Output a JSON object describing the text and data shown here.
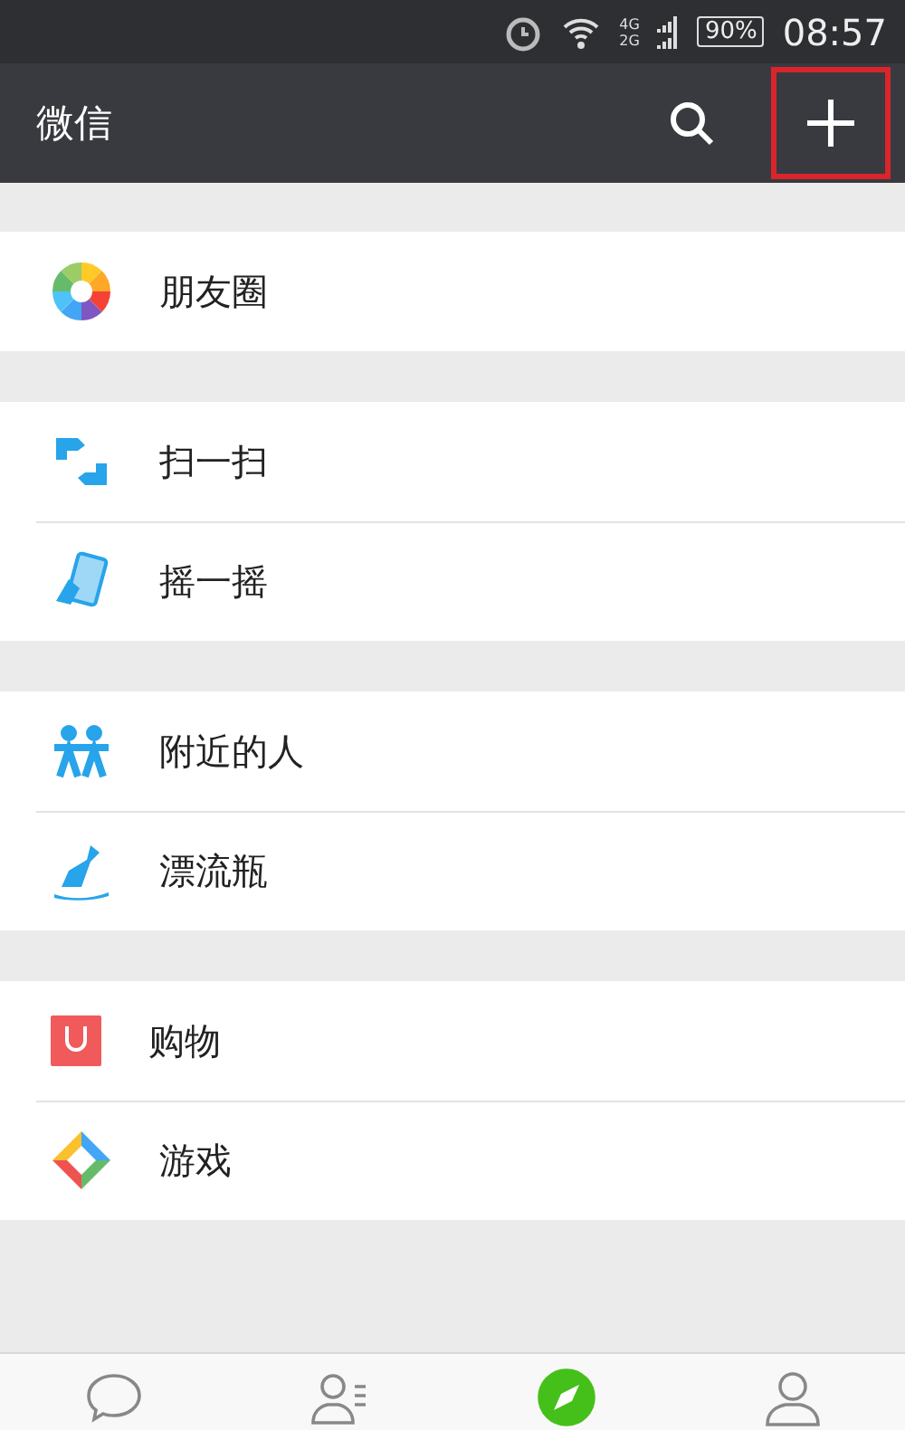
{
  "status_bar": {
    "network_top": "4G",
    "network_bottom": "2G",
    "battery": "90%",
    "time": "08:57"
  },
  "header": {
    "title": "微信",
    "add_button": {
      "highlighted": true
    }
  },
  "groups": [
    {
      "items": [
        {
          "kind": "moments",
          "label": "朋友圈"
        }
      ]
    },
    {
      "items": [
        {
          "kind": "scan",
          "label": "扫一扫"
        },
        {
          "kind": "shake",
          "label": "摇一摇"
        }
      ]
    },
    {
      "items": [
        {
          "kind": "nearby",
          "label": "附近的人"
        },
        {
          "kind": "bottle",
          "label": "漂流瓶"
        }
      ]
    },
    {
      "items": [
        {
          "kind": "shopping",
          "label": "购物"
        },
        {
          "kind": "games",
          "label": "游戏"
        }
      ]
    }
  ],
  "tab_bar": [
    {
      "kind": "chats",
      "selected": false
    },
    {
      "kind": "contacts",
      "selected": false
    },
    {
      "kind": "discover",
      "selected": true
    },
    {
      "kind": "me",
      "selected": false
    }
  ]
}
